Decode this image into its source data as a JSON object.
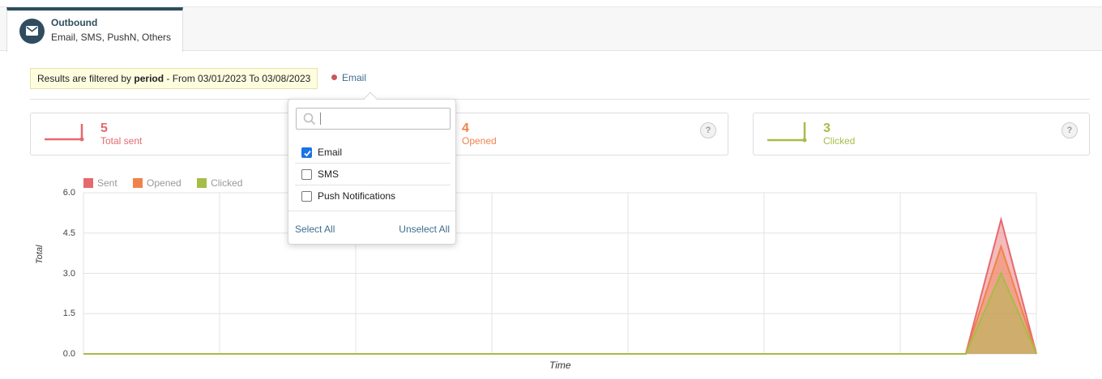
{
  "tab": {
    "title": "Outbound",
    "subtitle": "Email, SMS, PushN, Others",
    "icon": "envelope-icon"
  },
  "filter": {
    "prefix": "Results are filtered by ",
    "bold": "period",
    "suffix": " - From 03/01/2023 To 03/08/2023"
  },
  "channel_chip": {
    "label": "Email",
    "dot_color": "#c9585c"
  },
  "cards": [
    {
      "value": "5",
      "label": "Total sent",
      "color": "#e5696d"
    },
    {
      "value": "4",
      "label": "Opened",
      "color": "#f0834b"
    },
    {
      "value": "3",
      "label": "Clicked",
      "color": "#a5bd49"
    }
  ],
  "help_glyph": "?",
  "dropdown": {
    "search_value": "",
    "options": [
      {
        "label": "Email",
        "checked": true
      },
      {
        "label": "SMS",
        "checked": false
      },
      {
        "label": "Push Notifications",
        "checked": false
      }
    ],
    "select_all": "Select All",
    "unselect_all": "Unselect All"
  },
  "chart_data": {
    "type": "area",
    "ylabel": "Total",
    "xlabel": "Time",
    "ylim": [
      0,
      6
    ],
    "yticks": [
      "0.0",
      "1.5",
      "3.0",
      "4.5",
      "6.0"
    ],
    "grid": true,
    "legend_position": "top-left",
    "x_points": 28,
    "series": [
      {
        "name": "Sent",
        "color": "#e5696d",
        "values": [
          0,
          0,
          0,
          0,
          0,
          0,
          0,
          0,
          0,
          0,
          0,
          0,
          0,
          0,
          0,
          0,
          0,
          0,
          0,
          0,
          0,
          0,
          0,
          0,
          0,
          0,
          5,
          0
        ]
      },
      {
        "name": "Opened",
        "color": "#f0834b",
        "values": [
          0,
          0,
          0,
          0,
          0,
          0,
          0,
          0,
          0,
          0,
          0,
          0,
          0,
          0,
          0,
          0,
          0,
          0,
          0,
          0,
          0,
          0,
          0,
          0,
          0,
          0,
          4,
          0
        ]
      },
      {
        "name": "Clicked",
        "color": "#a5bd49",
        "values": [
          0,
          0,
          0,
          0,
          0,
          0,
          0,
          0,
          0,
          0,
          0,
          0,
          0,
          0,
          0,
          0,
          0,
          0,
          0,
          0,
          0,
          0,
          0,
          0,
          0,
          0,
          3,
          0
        ]
      }
    ]
  }
}
